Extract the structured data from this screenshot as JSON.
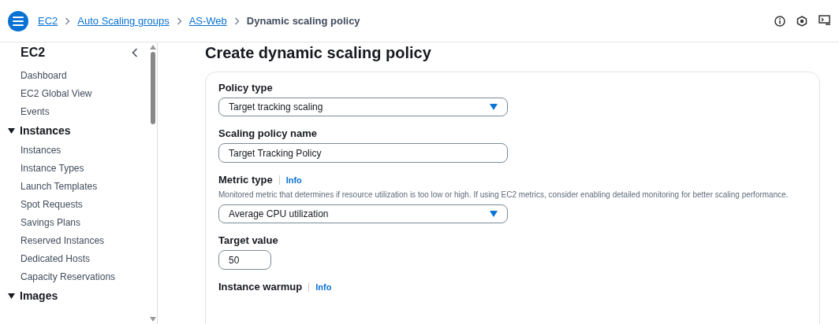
{
  "breadcrumbs": [
    {
      "label": "EC2",
      "kind": "link"
    },
    {
      "label": "Auto Scaling groups",
      "kind": "link"
    },
    {
      "label": "AS-Web",
      "kind": "link"
    },
    {
      "label": "Dynamic scaling policy",
      "kind": "current"
    }
  ],
  "sidebar": {
    "title": "EC2",
    "items": [
      {
        "label": "Dashboard",
        "kind": "link"
      },
      {
        "label": "EC2 Global View",
        "kind": "link"
      },
      {
        "label": "Events",
        "kind": "link"
      },
      {
        "label": "Instances",
        "kind": "section",
        "expanded": true,
        "children": [
          {
            "label": "Instances"
          },
          {
            "label": "Instance Types"
          },
          {
            "label": "Launch Templates"
          },
          {
            "label": "Spot Requests"
          },
          {
            "label": "Savings Plans"
          },
          {
            "label": "Reserved Instances"
          },
          {
            "label": "Dedicated Hosts"
          },
          {
            "label": "Capacity Reservations"
          }
        ]
      },
      {
        "label": "Images",
        "kind": "section",
        "expanded": true
      }
    ]
  },
  "page_title": "Create dynamic scaling policy",
  "fields": [
    {
      "kind": "select",
      "label": "Policy type",
      "value": "Target tracking scaling"
    },
    {
      "kind": "text",
      "label": "Scaling policy name",
      "value": "Target Tracking Policy"
    },
    {
      "kind": "select",
      "label": "Metric type",
      "info": "Info",
      "description": "Monitored metric that determines if resource utilization is too low or high. If using EC2 metrics, consider enabling detailed monitoring for better scaling performance.",
      "value": "Average CPU utilization"
    },
    {
      "kind": "number",
      "label": "Target value",
      "value": "50"
    },
    {
      "kind": "heading",
      "label": "Instance warmup",
      "info": "Info"
    }
  ]
}
